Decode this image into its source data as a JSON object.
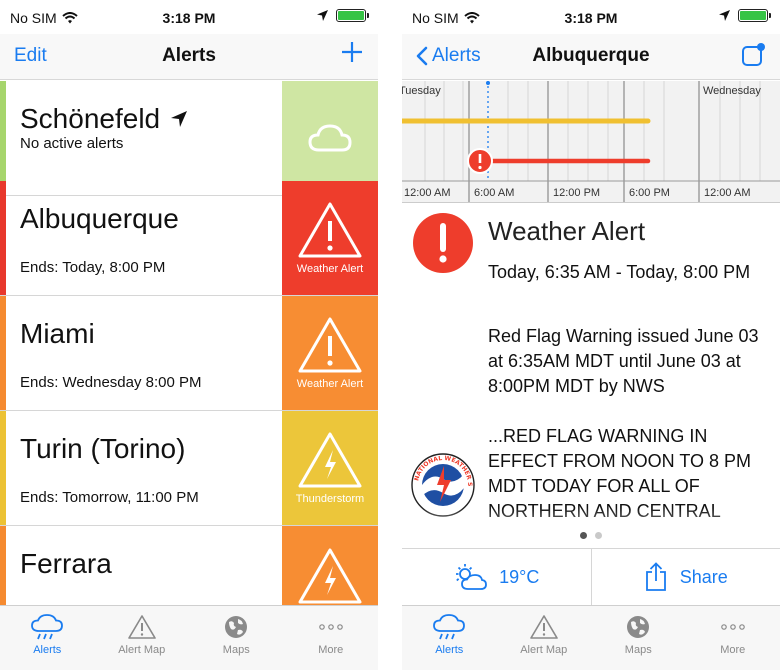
{
  "status": {
    "carrier": "No SIM",
    "time": "3:18 PM"
  },
  "left": {
    "nav": {
      "edit": "Edit",
      "title": "Alerts",
      "add": "+"
    },
    "rows": [
      {
        "city": "Schönefeld",
        "sub": "No active alerts",
        "tile_label": "",
        "stripe": "#a6d56c",
        "tile_color": "#cfe6a3"
      },
      {
        "city": "Albuquerque",
        "sub": "Ends: Today, 8:00 PM",
        "tile_label": "Weather Alert",
        "stripe": "#e8382c",
        "tile_color": "#ee3d2c"
      },
      {
        "city": "Miami",
        "sub": "Ends: Wednesday 8:00 PM",
        "tile_label": "Weather Alert",
        "stripe": "#f58a30",
        "tile_color": "#f78d33"
      },
      {
        "city": "Turin (Torino)",
        "sub": "Ends: Tomorrow, 11:00 PM",
        "tile_label": "Thunderstorm",
        "stripe": "#ecc234",
        "tile_color": "#ecc63a"
      },
      {
        "city": "Ferrara",
        "sub": "",
        "tile_label": "",
        "stripe": "#f58a30",
        "tile_color": "#f78d33"
      }
    ]
  },
  "right": {
    "nav": {
      "back": "Alerts",
      "title": "Albuquerque"
    },
    "timeline": {
      "day_labels": [
        "Tuesday",
        "Wednesday"
      ],
      "time_labels": [
        "12:00 AM",
        "6:00 AM",
        "12:00 PM",
        "6:00 PM",
        "12:00 AM"
      ]
    },
    "detail": {
      "heading": "Weather Alert",
      "period": "Today, 6:35 AM - Today, 8:00 PM",
      "summary": "Red Flag Warning issued June 03 at 6:35AM MDT until June 03 at 8:00PM MDT by NWS",
      "body": "...RED FLAG WARNING IN EFFECT FROM NOON TO 8 PM MDT TODAY FOR ALL OF NORTHERN AND CENTRAL",
      "seal_text": "NATIONAL WEATHER SERVICE"
    },
    "actions": {
      "temperature": "19°C",
      "share": "Share"
    }
  },
  "tabs": [
    "Alerts",
    "Alert Map",
    "Maps",
    "More"
  ],
  "colors": {
    "accent": "#1a7cf0",
    "alert_red": "#ee3d2c",
    "advisory_yellow": "#f0c031"
  }
}
